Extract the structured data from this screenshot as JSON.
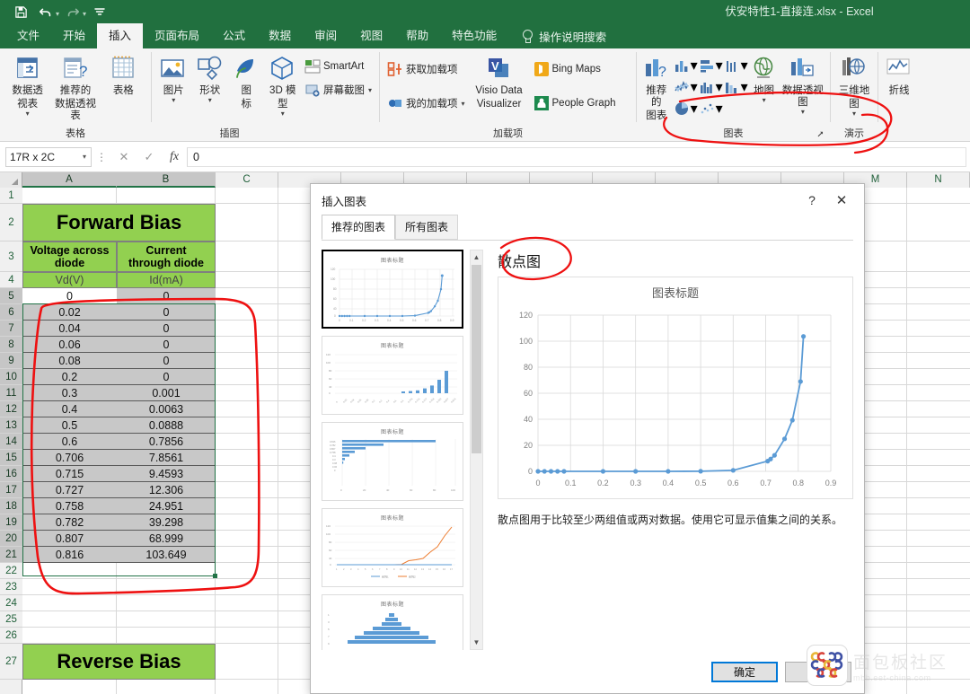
{
  "window": {
    "title": "伏安特性1-直接连.xlsx  -  Excel",
    "quick_access": [
      "save-icon",
      "undo-icon",
      "redo-icon",
      "customize-icon"
    ]
  },
  "ribbon": {
    "tabs": [
      {
        "label": "文件",
        "active": false
      },
      {
        "label": "开始",
        "active": false
      },
      {
        "label": "插入",
        "active": true
      },
      {
        "label": "页面布局",
        "active": false
      },
      {
        "label": "公式",
        "active": false
      },
      {
        "label": "数据",
        "active": false
      },
      {
        "label": "审阅",
        "active": false
      },
      {
        "label": "视图",
        "active": false
      },
      {
        "label": "帮助",
        "active": false
      },
      {
        "label": "特色功能",
        "active": false
      }
    ],
    "tell_me": "操作说明搜索",
    "groups": [
      {
        "name": "表格",
        "label": "表格",
        "big_buttons": [
          {
            "label1": "数据透",
            "label2": "视表",
            "caret": true,
            "icon": "pivot-table-icon"
          },
          {
            "label1": "推荐的",
            "label2": "数据透视表",
            "caret": false,
            "icon": "recommended-pivot-icon"
          },
          {
            "label1": "表格",
            "label2": "",
            "caret": false,
            "icon": "table-icon"
          }
        ]
      },
      {
        "name": "插图",
        "label": "插图",
        "big_buttons": [
          {
            "label1": "图片",
            "label2": "",
            "caret": true,
            "icon": "picture-icon"
          },
          {
            "label1": "形状",
            "label2": "",
            "caret": true,
            "icon": "shapes-icon"
          },
          {
            "label1": "图",
            "label2": "标",
            "caret": false,
            "icon": "icons-icon"
          },
          {
            "label1": "3D 模",
            "label2": "型",
            "caret": true,
            "icon": "3d-model-icon"
          }
        ],
        "small_buttons": [
          {
            "label": "SmartArt",
            "icon": "smartart-icon",
            "caret": false
          },
          {
            "label": "屏幕截图",
            "icon": "screenshot-icon",
            "caret": true
          }
        ]
      },
      {
        "name": "加载项",
        "label": "加载项",
        "small_buttons": [
          {
            "label": "获取加载项",
            "icon": "get-addins-icon",
            "caret": false
          },
          {
            "label": "我的加载项",
            "icon": "my-addins-icon",
            "caret": true
          }
        ],
        "big_buttons": [
          {
            "label1": "Visio Data",
            "label2": "Visualizer",
            "caret": false,
            "icon": "visio-icon"
          }
        ],
        "small_buttons2": [
          {
            "label": "Bing Maps",
            "icon": "bing-maps-icon",
            "caret": false
          },
          {
            "label": "People Graph",
            "icon": "people-graph-icon",
            "caret": false
          }
        ]
      },
      {
        "name": "图表",
        "label": "图表",
        "has_launcher": true,
        "big_buttons": [
          {
            "label1": "推荐的",
            "label2": "图表",
            "caret": false,
            "icon": "recommended-charts-icon"
          },
          {
            "label1": "地图",
            "label2": "",
            "caret": true,
            "icon": "map-chart-icon"
          },
          {
            "label1": "数据透视图",
            "label2": "",
            "caret": true,
            "icon": "pivot-chart-icon"
          }
        ],
        "chart_icons": [
          "column-chart-icon",
          "bar-chart-icon",
          "line-area-icon",
          "stock-chart-icon",
          "histogram-icon",
          "waterfall-icon",
          "pie-chart-icon",
          "scatter-chart-icon"
        ]
      },
      {
        "name": "演示",
        "label": "演示",
        "big_buttons": [
          {
            "label1": "三维地",
            "label2": "图",
            "caret": true,
            "icon": "3d-map-icon"
          }
        ]
      },
      {
        "name": "迷你图",
        "label": "",
        "big_buttons": [
          {
            "label1": "折线",
            "label2": "",
            "caret": false,
            "icon": "sparkline-line-icon"
          }
        ]
      }
    ]
  },
  "formula_bar": {
    "name_box": "17R x 2C",
    "value": "0",
    "cancel_icon": "x-icon",
    "confirm_icon": "check-icon",
    "fx_icon": "fx-icon"
  },
  "sheet": {
    "columns": [
      {
        "label": "A",
        "selected": true
      },
      {
        "label": "B",
        "selected": true
      },
      {
        "label": "C",
        "selected": false
      },
      {
        "label": "M",
        "selected": false
      },
      {
        "label": "N",
        "selected": false
      }
    ],
    "rows": [
      1,
      2,
      3,
      4,
      5,
      6,
      7,
      8,
      9,
      10,
      11,
      12,
      13,
      14,
      15,
      16,
      17,
      18,
      19,
      20,
      21,
      22,
      23,
      24,
      25,
      26,
      27
    ],
    "selected_rows": [
      5,
      6,
      7,
      8,
      9,
      10,
      11,
      12,
      13,
      14,
      15,
      16,
      17,
      18,
      19,
      20,
      21
    ],
    "forward_bias": {
      "banner": "Forward Bias",
      "header_a_line1": "Voltage across",
      "header_a_line2": "diode",
      "header_b_line1": "Current",
      "header_b_line2": "through diode",
      "unit_a": "Vd(V)",
      "unit_b": "Id(mA)",
      "data": [
        {
          "row": 5,
          "vd": "0",
          "id": "0"
        },
        {
          "row": 6,
          "vd": "0.02",
          "id": "0"
        },
        {
          "row": 7,
          "vd": "0.04",
          "id": "0"
        },
        {
          "row": 8,
          "vd": "0.06",
          "id": "0"
        },
        {
          "row": 9,
          "vd": "0.08",
          "id": "0"
        },
        {
          "row": 10,
          "vd": "0.2",
          "id": "0"
        },
        {
          "row": 11,
          "vd": "0.3",
          "id": "0.001"
        },
        {
          "row": 12,
          "vd": "0.4",
          "id": "0.0063"
        },
        {
          "row": 13,
          "vd": "0.5",
          "id": "0.0888"
        },
        {
          "row": 14,
          "vd": "0.6",
          "id": "0.7856"
        },
        {
          "row": 15,
          "vd": "0.706",
          "id": "7.8561"
        },
        {
          "row": 16,
          "vd": "0.715",
          "id": "9.4593"
        },
        {
          "row": 17,
          "vd": "0.727",
          "id": "12.306"
        },
        {
          "row": 18,
          "vd": "0.758",
          "id": "24.951"
        },
        {
          "row": 19,
          "vd": "0.782",
          "id": "39.298"
        },
        {
          "row": 20,
          "vd": "0.807",
          "id": "68.999"
        },
        {
          "row": 21,
          "vd": "0.816",
          "id": "103.649"
        }
      ]
    },
    "reverse_bias": {
      "banner": "Reverse Bias"
    }
  },
  "dialog": {
    "title": "插入图表",
    "help_icon": "question-mark-icon",
    "close_icon": "close-icon",
    "tabs": [
      {
        "label": "推荐的图表",
        "active": true
      },
      {
        "label": "所有图表",
        "active": false
      }
    ],
    "preview_heading": "散点图",
    "description": "散点图用于比较至少两组值或两对数据。使用它可显示值集之间的关系。",
    "thumbnail_titles": [
      "图表标题",
      "图表标题",
      "图表标题",
      "图表标题",
      "图表标题"
    ],
    "thumbnail_legend": [
      "系列1",
      "系列2"
    ],
    "buttons": [
      {
        "label": "确定",
        "primary": true
      },
      {
        "label": "取消",
        "primary": false
      }
    ],
    "scroll_up_icon": "chevron-up-icon",
    "scroll_down_icon": "chevron-down-icon"
  },
  "chart_data": {
    "type": "scatter",
    "title": "图表标题",
    "xlabel": "",
    "ylabel": "",
    "xlim": [
      0,
      0.9
    ],
    "ylim": [
      0,
      120
    ],
    "xticks": [
      "0",
      "0.1",
      "0.2",
      "0.3",
      "0.4",
      "0.5",
      "0.6",
      "0.7",
      "0.8",
      "0.9"
    ],
    "yticks": [
      "0",
      "20",
      "40",
      "60",
      "80",
      "100",
      "120"
    ],
    "grid": true,
    "legend": "none",
    "series": [
      {
        "name": "Id(mA)",
        "color": "#5b9bd5",
        "x": [
          0,
          0.02,
          0.04,
          0.06,
          0.08,
          0.2,
          0.3,
          0.4,
          0.5,
          0.6,
          0.706,
          0.715,
          0.727,
          0.758,
          0.782,
          0.807,
          0.816
        ],
        "y": [
          0,
          0,
          0,
          0,
          0,
          0,
          0.001,
          0.0063,
          0.0888,
          0.7856,
          7.8561,
          9.4593,
          12.306,
          24.951,
          39.298,
          68.999,
          103.649
        ]
      }
    ]
  },
  "watermark": {
    "cn": "面包板社区",
    "en": "mbb.eet-china.com"
  },
  "colors": {
    "excel_green": "#21703f",
    "accent_green": "#217346",
    "banner_green": "#92d050",
    "series_blue": "#5b9bd5",
    "ink_red": "#ee1111"
  }
}
